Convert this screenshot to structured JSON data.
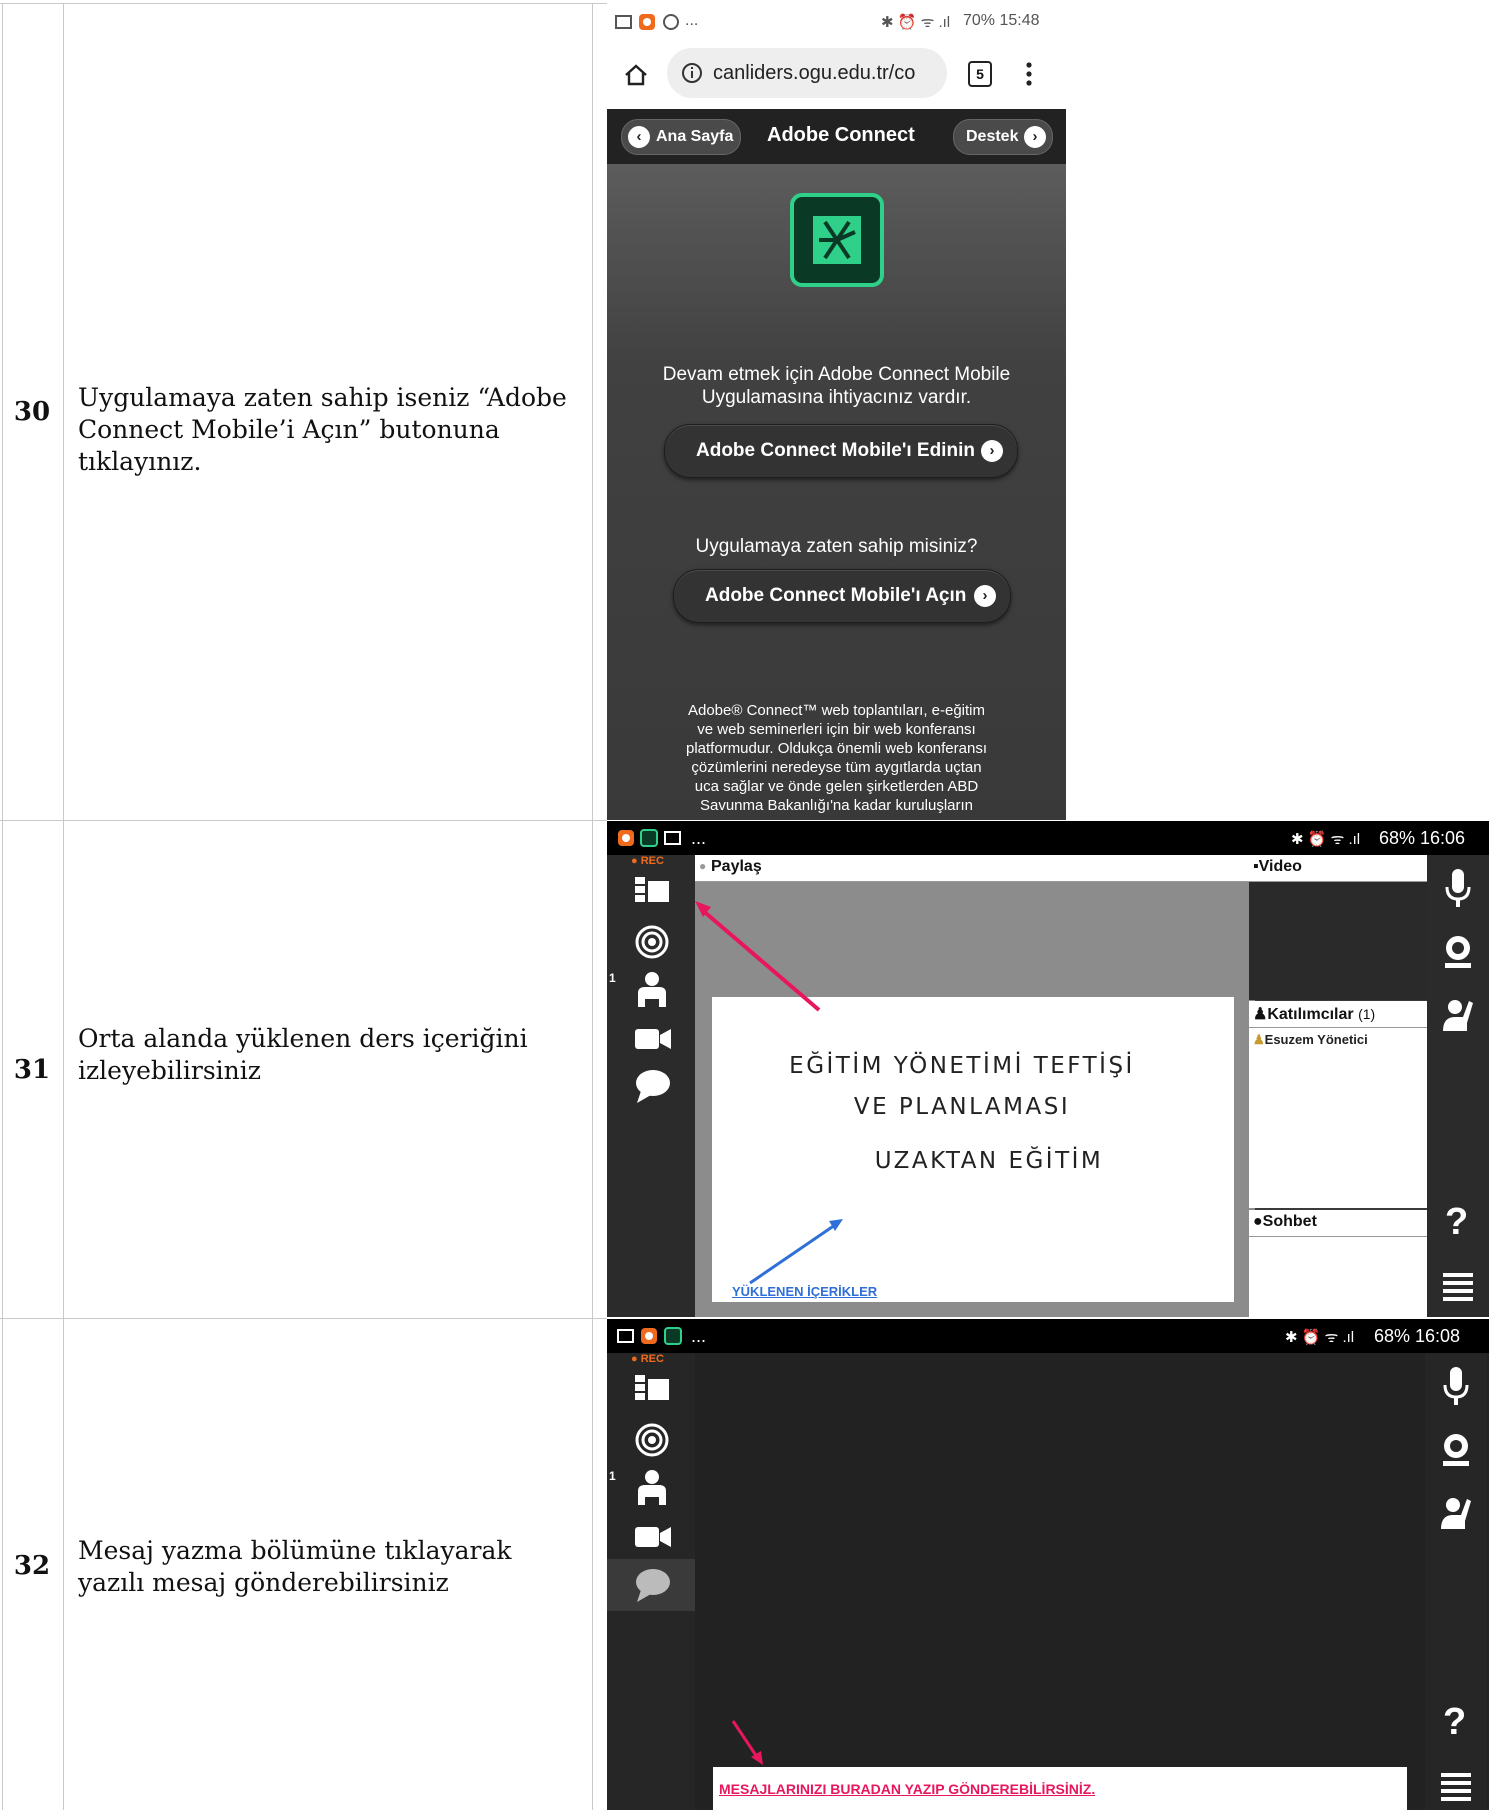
{
  "rows": [
    {
      "num": "30",
      "text": "Uygulamaya zaten sahip iseniz “Adobe Connect Mobile’i Açın” butonuna tıklayınız."
    },
    {
      "num": "31",
      "text": "Orta alanda yüklenen ders içeriğini izleyebilirsiniz"
    },
    {
      "num": "32",
      "text": "Mesaj yazma bölümüne tıklayarak yazılı mesaj gönderebilirsiniz"
    }
  ],
  "screen30": {
    "status_left": "...",
    "status_right": "70% 15:48",
    "url": "canliders.ogu.edu.tr/co",
    "tab_count": "5",
    "back_label": "Ana Sayfa",
    "title": "Adobe Connect",
    "help_label": "Destek",
    "intro_line1": "Devam etmek için Adobe Connect Mobile",
    "intro_line2": "Uygulamasına ihtiyacınız vardır.",
    "get_button": "Adobe Connect Mobile'ı Edinin",
    "question": "Uygulamaya zaten sahip misiniz?",
    "open_button": "Adobe Connect Mobile'ı Açın",
    "footer_lines": [
      "Adobe® Connect™ web toplantıları, e-eğitim",
      "ve web seminerleri için bir web konferansı",
      "platformudur. Oldukça önemli web konferansı",
      "çözümlerini neredeyse tüm aygıtlarda uçtan",
      "uca sağlar ve önde gelen şirketlerden ABD",
      "Savunma Bakanlığı'na kadar kuruluşların"
    ]
  },
  "screen31": {
    "status_left": "...",
    "status_right": "68% 16:06",
    "rec": "REC",
    "share_title": "Paylaş",
    "video_title": "Video",
    "attendees_title": "Katılımcılar",
    "attendees_count": "(1)",
    "attendee_name": "Esuzem Yönetici",
    "chat_title": "Sohbet",
    "slide_line1": "EĞİTİM YÖNETİMİ TEFTİŞİ",
    "slide_line2": "VE PLANLAMASI",
    "slide_line3": "UZAKTAN EĞİTİM",
    "annotation": "YÜKLENEN İÇERİKLER",
    "badge": "1"
  },
  "screen32": {
    "status_left": "...",
    "status_right": "68% 16:08",
    "rec": "REC",
    "badge": "1",
    "annotation": "MESAJLARINIZI BURADAN YAZIP GÖNDEREBİLİRSİNİZ."
  },
  "colors": {
    "accent_red": "#e8175d",
    "annotation_blue": "#2f6fd8",
    "adobe_green": "#2fd18a"
  }
}
